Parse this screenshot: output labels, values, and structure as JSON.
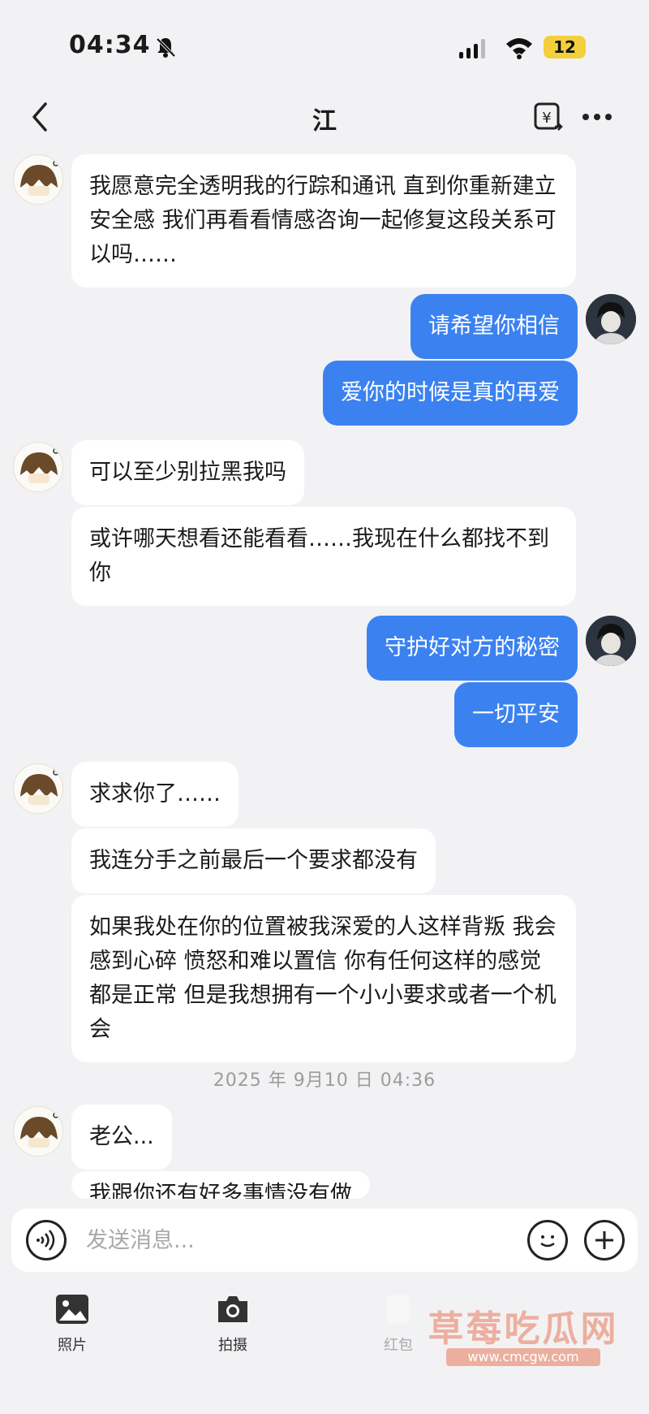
{
  "status_bar": {
    "time": "04:34",
    "battery_level": "12",
    "icons": [
      "bell-muted-icon",
      "cellular-signal-icon",
      "wifi-icon",
      "battery-icon"
    ]
  },
  "nav": {
    "title": "江",
    "icons": [
      "back-arrow-icon",
      "translate-icon",
      "more-icon"
    ]
  },
  "messages": [
    {
      "sender": "other",
      "text": "我愿意完全透明我的行踪和通讯 直到你重新建立安全感 我们再看看情感咨询一起修复这段关系可以吗……"
    },
    {
      "sender": "me",
      "text": "请希望你相信"
    },
    {
      "sender": "me",
      "text": "爱你的时候是真的再爱"
    },
    {
      "sender": "other",
      "text": "可以至少别拉黑我吗"
    },
    {
      "sender": "other",
      "text": "或许哪天想看还能看看……我现在什么都找不到你"
    },
    {
      "sender": "me",
      "text": "守护好对方的秘密"
    },
    {
      "sender": "me",
      "text": "一切平安"
    },
    {
      "sender": "other",
      "text": "求求你了……"
    },
    {
      "sender": "other",
      "text": "我连分手之前最后一个要求都没有"
    },
    {
      "sender": "other",
      "text": "如果我处在你的位置被我深爱的人这样背叛 我会感到心碎 愤怒和难以置信 你有任何这样的感觉都是正常 但是我想拥有一个小小要求或者一个机会"
    },
    {
      "sender": "other",
      "text": "老公..."
    },
    {
      "sender": "other",
      "text": "我跟你还有好多事情没有做"
    }
  ],
  "timestamp": "2025 年 9月10 日 04:36",
  "input": {
    "placeholder": "发送消息..."
  },
  "tools": [
    {
      "label": "照片",
      "icon": "photo-icon"
    },
    {
      "label": "拍摄",
      "icon": "camera-icon"
    },
    {
      "label": "红包",
      "icon": "red-envelope-icon"
    }
  ],
  "watermark": {
    "text": "草莓吃瓜网",
    "url": "www.cmcgw.com"
  },
  "colors": {
    "background": "#f2f2f4",
    "bubble_self": "#3b82f0",
    "bubble_other": "#ffffff",
    "battery": "#f3cf3b"
  }
}
